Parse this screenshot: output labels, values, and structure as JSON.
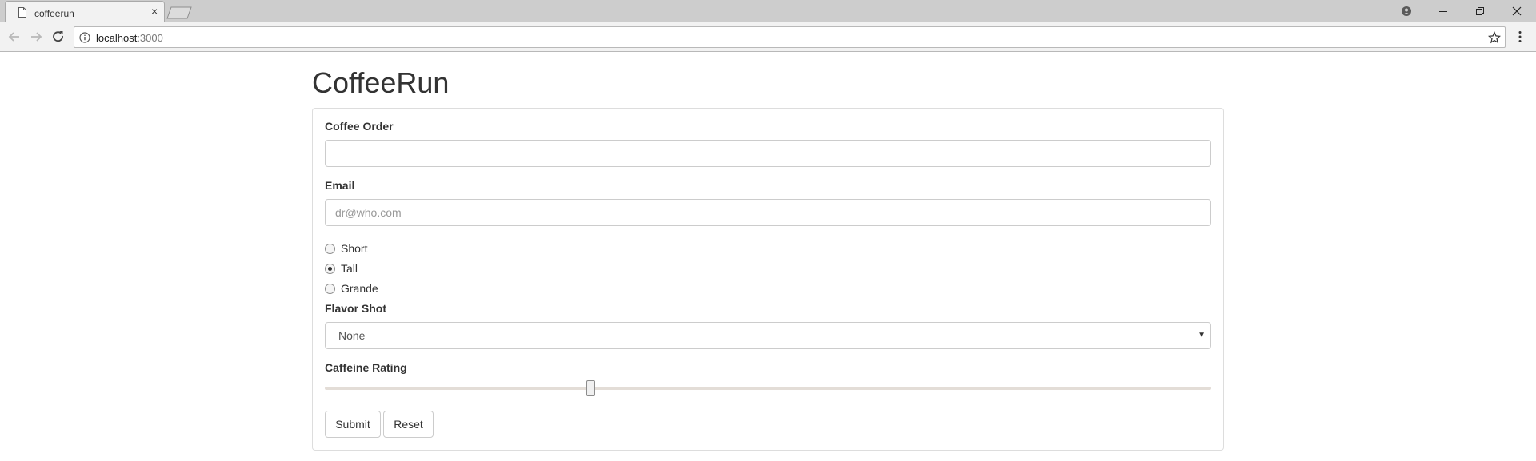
{
  "browser": {
    "tab_title": "coffeerun",
    "tab_close": "×",
    "url_host": "localhost",
    "url_port": ":3000"
  },
  "page": {
    "title": "CoffeeRun"
  },
  "form": {
    "coffee_order": {
      "label": "Coffee Order",
      "value": "",
      "placeholder": ""
    },
    "email": {
      "label": "Email",
      "value": "",
      "placeholder": "dr@who.com"
    },
    "size": {
      "options": [
        {
          "label": "Short",
          "checked": false
        },
        {
          "label": "Tall",
          "checked": true
        },
        {
          "label": "Grande",
          "checked": false
        }
      ]
    },
    "flavor": {
      "label": "Flavor Shot",
      "selected": "None"
    },
    "caffeine": {
      "label": "Caffeine Rating",
      "min": 0,
      "max": 100,
      "value": 30
    },
    "buttons": {
      "submit": "Submit",
      "reset": "Reset"
    }
  },
  "colors": {
    "text": "#333333",
    "border": "#cccccc",
    "chrome": "#f2f2f2"
  }
}
